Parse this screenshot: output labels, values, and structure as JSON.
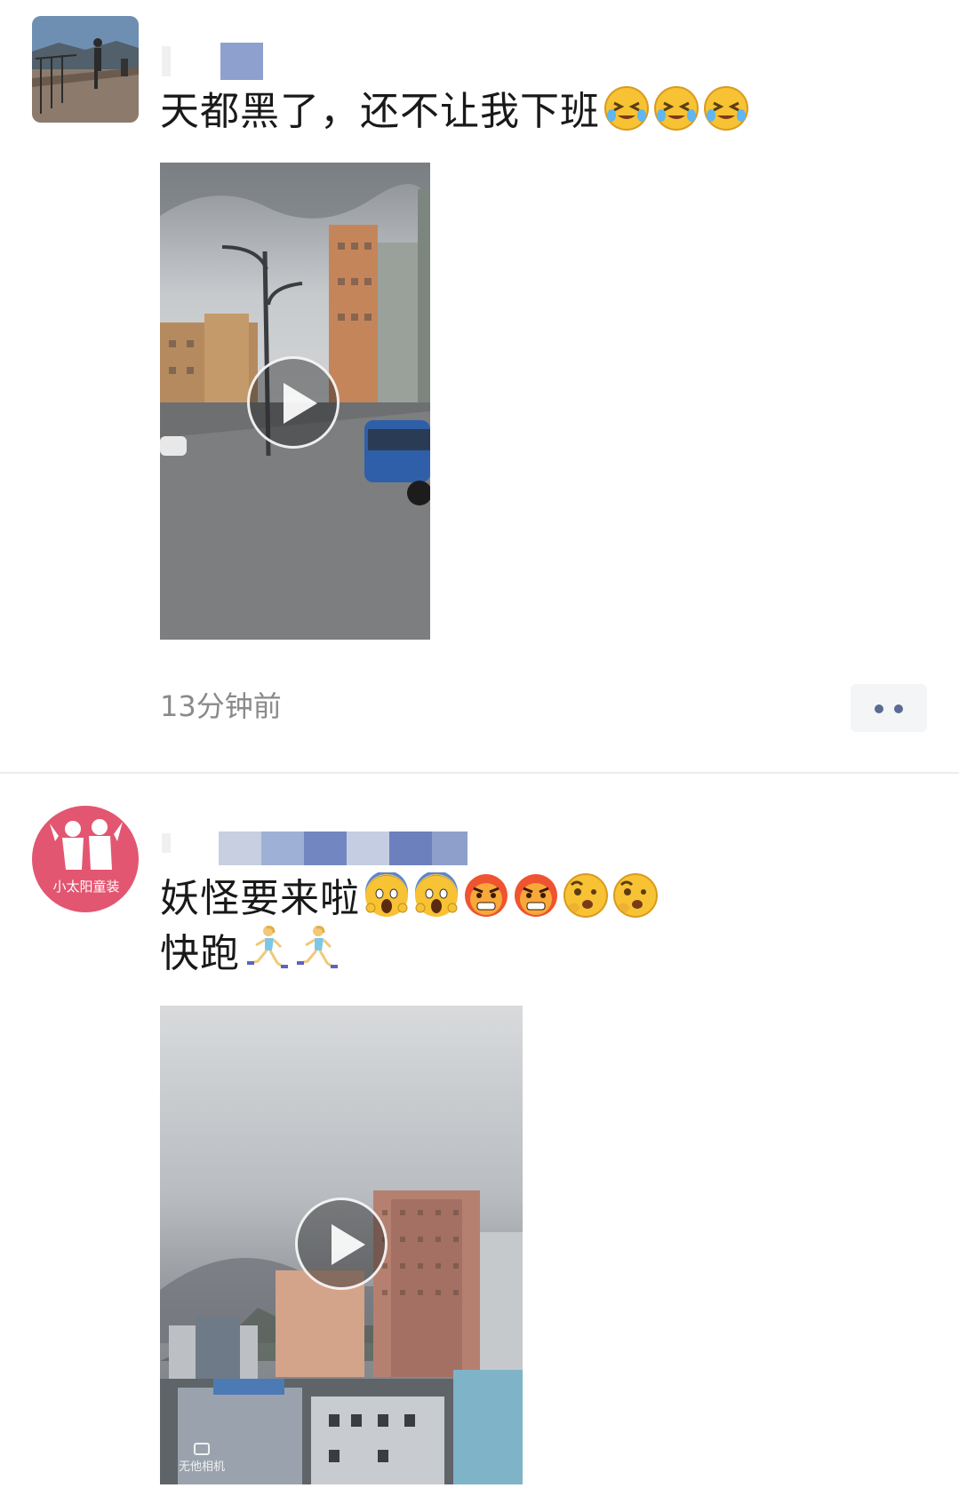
{
  "feed": {
    "posts": [
      {
        "avatar_icon": "landscape-photo-avatar",
        "text_lines": [
          "天都黑了，还不让我下班"
        ],
        "emojis": [
          "crying-laughing-face-icon",
          "crying-laughing-face-icon",
          "crying-laughing-face-icon"
        ],
        "video_icon": "play-icon",
        "timestamp": "13分钟前",
        "more_icon": "more-dots-icon"
      },
      {
        "avatar_text": "小太阳童装",
        "text_lines": [
          "妖怪要来啦",
          "快跑"
        ],
        "line1_emojis": [
          "screaming-face-icon",
          "screaming-face-icon",
          "angry-face-icon",
          "angry-face-icon",
          "raised-eyebrow-face-icon",
          "raised-eyebrow-face-icon"
        ],
        "line2_emojis": [
          "running-woman-icon",
          "running-woman-icon"
        ],
        "video_icon": "play-icon",
        "video_watermark": "无他相机"
      }
    ]
  },
  "colors": {
    "link_blue": "#576b95",
    "timestamp_gray": "#8a8a8a",
    "brand_pink": "#e25671"
  }
}
